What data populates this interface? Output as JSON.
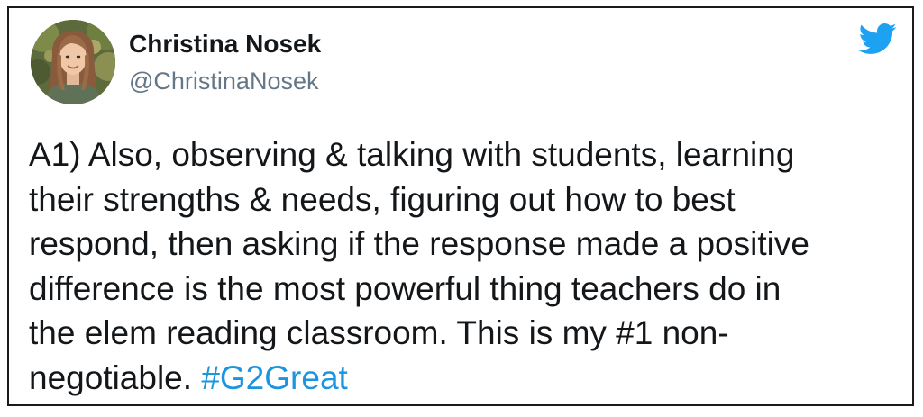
{
  "tweet": {
    "author": {
      "display_name": "Christina Nosek",
      "handle": "@ChristinaNosek"
    },
    "text_lines": [
      "A1) Also, observing & talking with students, learning",
      "their strengths & needs, figuring out how to best",
      "respond, then asking if the response made a positive",
      "difference is the most powerful thing teachers do in",
      "the elem reading classroom. This is my #1 non-",
      "negotiable."
    ],
    "hashtag": "#G2Great"
  },
  "icons": {
    "platform_logo": "twitter-bird-icon"
  },
  "colors": {
    "link": "#1b95e0",
    "twitter_brand": "#1da1f2",
    "name_text": "#14171a",
    "handle_text": "#657786",
    "border": "#1a1a1a"
  }
}
